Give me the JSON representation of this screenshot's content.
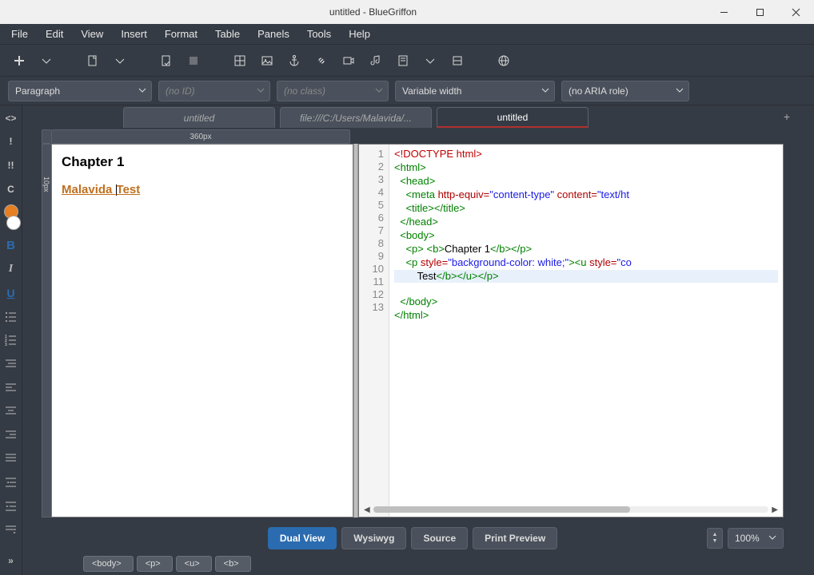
{
  "window": {
    "title": "untitled - BlueGriffon"
  },
  "menu": [
    "File",
    "Edit",
    "View",
    "Insert",
    "Format",
    "Table",
    "Panels",
    "Tools",
    "Help"
  ],
  "propbar": {
    "paragraph": "Paragraph",
    "id_placeholder": "(no ID)",
    "class_placeholder": "(no class)",
    "font": "Variable width",
    "aria": "(no ARIA role)"
  },
  "tabs": [
    {
      "label": "untitled",
      "active": false,
      "italic": true
    },
    {
      "label": "file:///C:/Users/Malavida/...",
      "active": false,
      "italic": true
    },
    {
      "label": "untitled",
      "active": true,
      "italic": false
    }
  ],
  "ruler_label": "360px",
  "wysiwyg": {
    "heading": "Chapter 1",
    "link_part1": "Malavida ",
    "link_part2": "Test"
  },
  "code_lines": [
    {
      "n": 1,
      "html": "<span class='t-dt'>&lt;!DOCTYPE html&gt;</span>"
    },
    {
      "n": 2,
      "html": "<span class='t-tag'>&lt;html&gt;</span>"
    },
    {
      "n": 3,
      "html": "  <span class='t-tag'>&lt;head&gt;</span>"
    },
    {
      "n": 4,
      "html": "    <span class='t-tag'>&lt;meta</span> <span class='t-attr'>http-equiv=</span><span class='t-str'>\"content-type\"</span> <span class='t-attr'>content=</span><span class='t-str'>\"text/ht</span>"
    },
    {
      "n": 5,
      "html": "    <span class='t-tag'>&lt;title&gt;&lt;/title&gt;</span>"
    },
    {
      "n": 6,
      "html": "  <span class='t-tag'>&lt;/head&gt;</span>"
    },
    {
      "n": 7,
      "html": "  <span class='t-tag'>&lt;body&gt;</span>"
    },
    {
      "n": 8,
      "html": "    <span class='t-tag'>&lt;p&gt;</span> <span class='t-tag'>&lt;b&gt;</span><span class='t-txt'>Chapter 1</span><span class='t-tag'>&lt;/b&gt;&lt;/p&gt;</span>"
    },
    {
      "n": 9,
      "html": "    <span class='t-tag'>&lt;p</span> <span class='t-attr'>style=</span><span class='t-str'>\"background-color: white;\"</span><span class='t-tag'>&gt;&lt;u</span> <span class='t-attr'>style=</span><span class='t-str'>\"co</span>"
    },
    {
      "n": 10,
      "html": "        <span class='t-txt'>Test</span><span class='t-tag'>&lt;/b&gt;&lt;/u&gt;&lt;/p&gt;</span>",
      "hl": true
    },
    {
      "n": 11,
      "html": "  <span class='t-tag'>&lt;/body&gt;</span>"
    },
    {
      "n": 12,
      "html": "<span class='t-tag'>&lt;/html&gt;</span>"
    },
    {
      "n": 13,
      "html": ""
    }
  ],
  "viewbar": {
    "dual": "Dual View",
    "wysiwyg": "Wysiwyg",
    "source": "Source",
    "preview": "Print Preview"
  },
  "zoom": "100%",
  "breadcrumb": [
    "<body>",
    "<p>",
    "<u>",
    "<b>"
  ]
}
